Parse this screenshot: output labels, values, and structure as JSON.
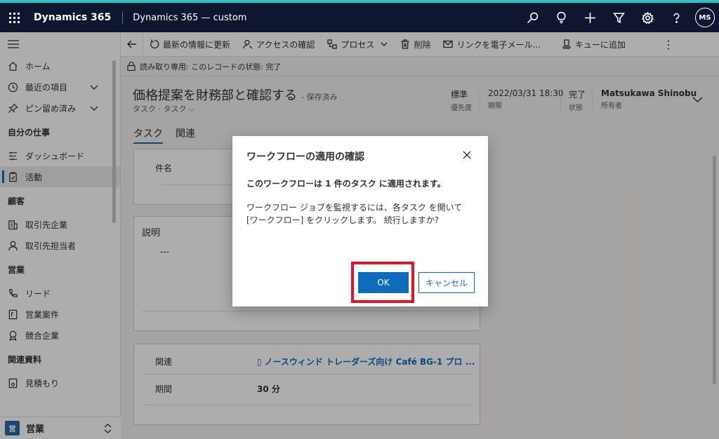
{
  "topbar": {
    "app_title": "Dynamics 365",
    "env_name": "Dynamics 365 — custom",
    "user_initials": "MS",
    "icons": [
      "search-icon",
      "lightbulb-icon",
      "plus-icon",
      "filter-icon",
      "gear-icon",
      "help-icon"
    ]
  },
  "sidebar": {
    "top_items": [
      {
        "label": "ホーム",
        "icon": "home-icon"
      },
      {
        "label": "最近の項目",
        "icon": "clock-icon"
      },
      {
        "label": "ピン留め済み",
        "icon": "pin-icon"
      }
    ],
    "groups": [
      {
        "title": "自分の仕事",
        "items": [
          {
            "label": "ダッシュボード"
          },
          {
            "label": "活動"
          }
        ]
      },
      {
        "title": "顧客",
        "items": [
          {
            "label": "取引先企業"
          },
          {
            "label": "取引先担当者"
          }
        ]
      },
      {
        "title": "営業",
        "items": [
          {
            "label": "リード"
          },
          {
            "label": "営業案件"
          },
          {
            "label": "競合企業"
          }
        ]
      },
      {
        "title": "関連資料",
        "items": [
          {
            "label": "見積もり"
          }
        ]
      }
    ],
    "area": {
      "badge": "営",
      "label": "営業"
    }
  },
  "commandbar": {
    "refresh": "最新の情報に更新",
    "check_access": "アクセスの確認",
    "process": "プロセス",
    "delete": "削除",
    "email_link": "リンクを電子メール...",
    "add_queue": "キューに追加"
  },
  "banner": {
    "text": "読み取り専用: このレコードの状態: 完了"
  },
  "record": {
    "title": "価格提案を財務部と確認する",
    "saved": "- 保存済み",
    "entity": "タスク · タスク",
    "priority_value": "標準",
    "priority_label": "優先度",
    "due_value": "2022/03/31 18:30",
    "due_label": "期限",
    "status_value": "完了",
    "status_label": "状態",
    "owner_value": "Matsukawa Shinobu",
    "owner_label": "所有者"
  },
  "tabs": {
    "task": "タスク",
    "related": "関連"
  },
  "form": {
    "subject_label": "件名",
    "description_label": "説明",
    "description_value": "---",
    "regarding_label": "関連",
    "regarding_value": "ノースウィンド トレーダーズ向け Café BG-1 プロ ...",
    "duration_label": "期間",
    "duration_value": "30 分"
  },
  "dialog": {
    "title": "ワークフローの適用の確認",
    "subtitle": "このワークフローは 1 件のタスク に適用されます。",
    "body": "ワークフロー ジョブを監視するには、各タスク を開いて [ワークフロー] をクリックします。 続行しますか?",
    "ok_label": "OK",
    "cancel_label": "キャンセル"
  },
  "colors": {
    "accent": "#0f6cbd",
    "topbar": "#0f1730",
    "highlight": "#e0152a"
  }
}
